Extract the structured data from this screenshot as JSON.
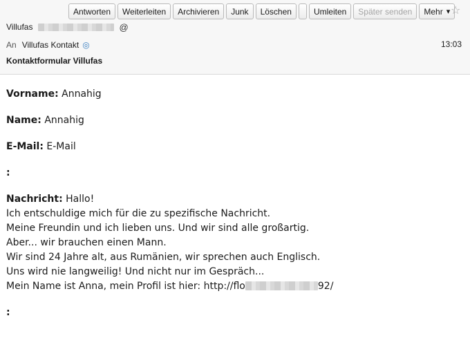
{
  "toolbar": {
    "reply": "Antworten",
    "forward": "Weiterleiten",
    "archive": "Archivieren",
    "junk": "Junk",
    "delete": "Löschen",
    "redirect": "Umleiten",
    "send_later": "Später senden",
    "more": "Mehr"
  },
  "header": {
    "from_name": "Villufas",
    "to_label": "An",
    "to_name": "Villufas Kontakt",
    "time": "13:03",
    "subject": "Kontaktformular Villufas"
  },
  "body": {
    "vorname_label": "Vorname:",
    "vorname_value": "Annahig",
    "name_label": "Name:",
    "name_value": "Annahig",
    "email_label": "E-Mail:",
    "email_value": "E-Mail",
    "colon1": ":",
    "nachricht_label": "Nachricht:",
    "nachricht_first": "Hallo!",
    "lines": [
      "Ich entschuldige mich für die zu spezifische Nachricht.",
      "Meine Freundin und ich lieben uns. Und wir sind alle großartig.",
      "Aber... wir brauchen einen Mann.",
      "Wir sind 24 Jahre alt, aus Rumänien, wir sprechen auch Englisch.",
      "Uns wird nie langweilig! Und nicht nur im Gespräch..."
    ],
    "profile_prefix": "Mein Name ist Anna, mein Profil ist hier: http://flo",
    "profile_suffix": "92/",
    "colon2": ":"
  }
}
